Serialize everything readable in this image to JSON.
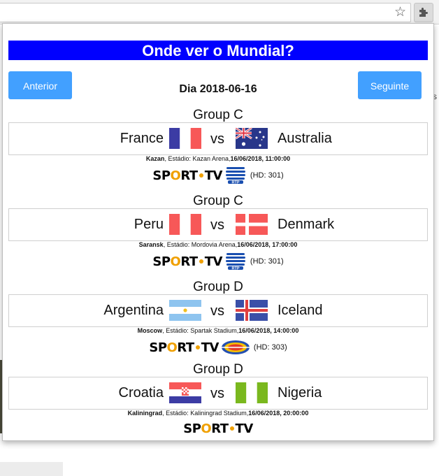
{
  "browser": {
    "icons": {
      "bookmark": "star-icon",
      "extension": "puzzle-icon"
    },
    "bg_text": "s"
  },
  "popup": {
    "title": "Onde ver o Mundial?",
    "prev_label": "Anterior",
    "next_label": "Seguinte",
    "day_label": "Dia 2018-06-16",
    "colors": {
      "title_bg": "#0000ff",
      "button_bg": "#42a0ff"
    }
  },
  "matches": [
    {
      "group": "Group C",
      "home": "France",
      "home_flag": "france-flag",
      "vs": "vs",
      "away": "Australia",
      "away_flag": "australia-flag",
      "city": "Kazan",
      "venue": ", Estádio: Kazan Arena,",
      "datetime": "16/06/2018, 11:00:00",
      "channels": [
        "SPORT TV",
        "RTP"
      ],
      "hd": "(HD: 301)"
    },
    {
      "group": "Group C",
      "home": "Peru",
      "home_flag": "peru-flag",
      "vs": "vs",
      "away": "Denmark",
      "away_flag": "denmark-flag",
      "city": "Saransk",
      "venue": ", Estádio: Mordovia Arena,",
      "datetime": "16/06/2018, 17:00:00",
      "channels": [
        "SPORT TV",
        "RTP"
      ],
      "hd": "(HD: 301)"
    },
    {
      "group": "Group D",
      "home": "Argentina",
      "home_flag": "argentina-flag",
      "vs": "vs",
      "away": "Iceland",
      "away_flag": "iceland-flag",
      "city": "Moscow",
      "venue": ", Estádio: Spartak Stadium,",
      "datetime": "16/06/2018, 14:00:00",
      "channels": [
        "SPORT TV",
        "SIC"
      ],
      "hd": "(HD: 303)"
    },
    {
      "group": "Group D",
      "home": "Croatia",
      "home_flag": "croatia-flag",
      "vs": "vs",
      "away": "Nigeria",
      "away_flag": "nigeria-flag",
      "city": "Kaliningrad",
      "venue": ", Estádio: Kaliningrad Stadium,",
      "datetime": "16/06/2018, 20:00:00",
      "channels": [
        "SPORT TV"
      ],
      "hd": ""
    }
  ]
}
